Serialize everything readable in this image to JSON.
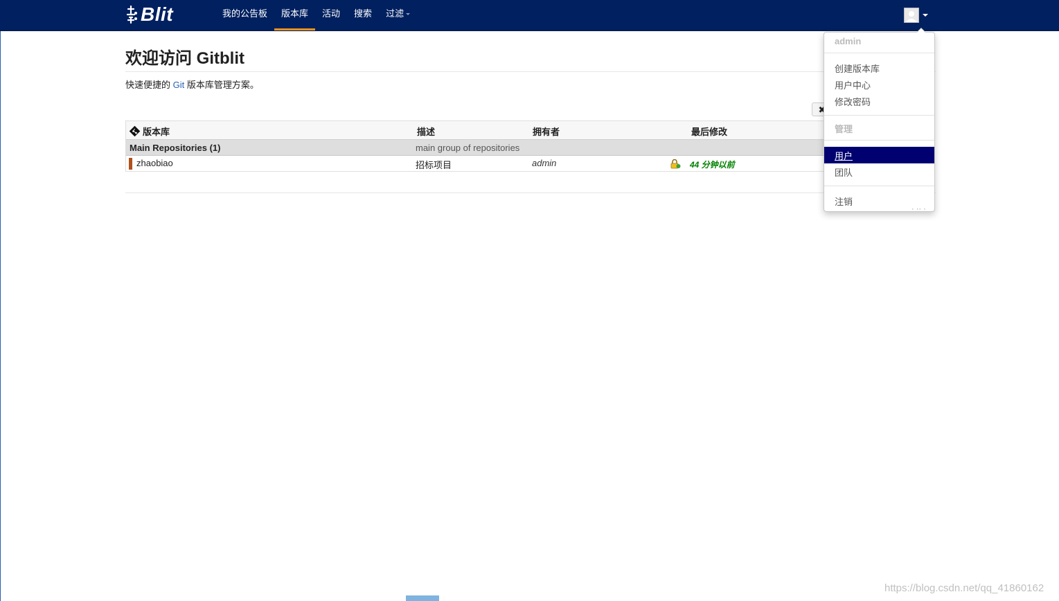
{
  "brand": {
    "logo_text": "Blit"
  },
  "nav": {
    "items": [
      {
        "label": "我的公告板",
        "active": false
      },
      {
        "label": "版本库",
        "active": true
      },
      {
        "label": "活动",
        "active": false
      },
      {
        "label": "搜索",
        "active": false
      },
      {
        "label": "过滤",
        "active": false,
        "has_caret": true
      }
    ]
  },
  "page": {
    "title": "欢迎访问 Gitblit",
    "subtitle_prefix": "快速便捷的 ",
    "subtitle_link": "Git",
    "subtitle_suffix": " 版本库管理方案。",
    "close_icon": "✖"
  },
  "table": {
    "headers": {
      "repo": "版本库",
      "desc": "描述",
      "owner": "拥有者",
      "modified": "最后修改"
    },
    "group": {
      "name": "Main Repositories (1)",
      "description": "main group of repositories"
    },
    "rows": [
      {
        "name": "zhaobiao",
        "description": "招标项目",
        "owner": "admin",
        "modified": "44 分钟以前",
        "icon": "lock-icon"
      }
    ]
  },
  "user_menu": {
    "username": "admin",
    "items": [
      "创建版本库",
      "用户中心",
      "修改密码"
    ],
    "admin_header": "管理",
    "admin_items": [
      "用户",
      "团队"
    ],
    "logout": "注销",
    "peek_text": "· ·· ·"
  },
  "watermark": "https://blog.csdn.net/qq_41860162",
  "colors": {
    "navbar": "#002060",
    "nav_active_underline": "#e8921e",
    "menu_highlight": "#000070",
    "modified_green": "#008000",
    "link_blue": "#2a62b6",
    "repo_bar": "#b0521c"
  }
}
